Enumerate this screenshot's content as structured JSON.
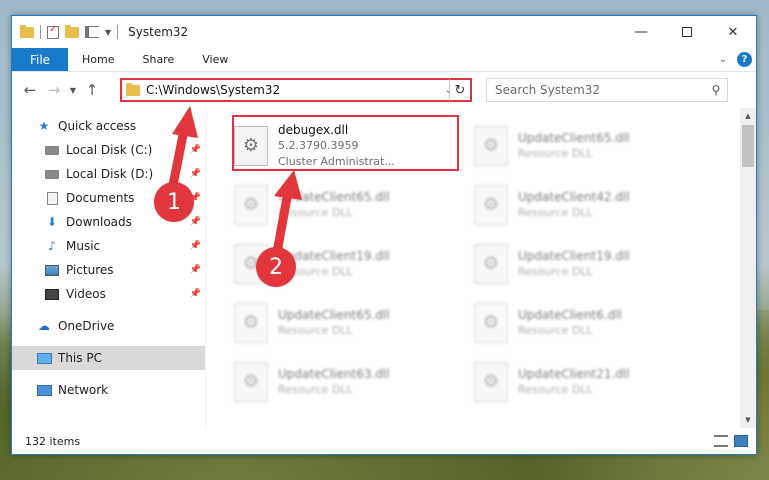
{
  "window": {
    "title": "System32",
    "controls": {
      "minimize": "—",
      "maximize": "",
      "close": "✕"
    }
  },
  "ribbon": {
    "tabs": [
      "File",
      "Home",
      "Share",
      "View"
    ],
    "help": "?"
  },
  "address_bar": {
    "path": "C:\\Windows\\System32",
    "search_placeholder": "Search System32"
  },
  "sidebar": {
    "quick_access": "Quick access",
    "pinned": [
      "Local Disk (C:)",
      "Local Disk (D:)",
      "Documents",
      "Downloads",
      "Music",
      "Pictures",
      "Videos"
    ],
    "onedrive": "OneDrive",
    "this_pc": "This PC",
    "network": "Network"
  },
  "files": [
    {
      "name": "debugex.dll",
      "line1": "5.2.3790.3959",
      "line2": "Cluster Administrat...",
      "blurred": false
    },
    {
      "name": "UpdateClient65.dll",
      "line1": "Resource DLL",
      "blurred": true
    },
    {
      "name": "UpdateClient65.dll",
      "line1": "Resource DLL",
      "blurred": true
    },
    {
      "name": "UpdateClient42.dll",
      "line1": "Resource DLL",
      "blurred": true
    },
    {
      "name": "UpdateClient19.dll",
      "line1": "Resource DLL",
      "blurred": true
    },
    {
      "name": "UpdateClient19.dll",
      "line1": "Resource DLL",
      "blurred": true
    },
    {
      "name": "UpdateClient65.dll",
      "line1": "Resource DLL",
      "blurred": true
    },
    {
      "name": "UpdateClient6.dll",
      "line1": "Resource DLL",
      "blurred": true
    },
    {
      "name": "UpdateClient63.dll",
      "line1": "Resource DLL",
      "blurred": true
    },
    {
      "name": "UpdateClient21.dll",
      "line1": "Resource DLL",
      "blurred": true
    }
  ],
  "status": {
    "item_count": "132 items"
  },
  "callouts": [
    "1",
    "2"
  ],
  "colors": {
    "accent": "#1979ca",
    "highlight": "#d9373d"
  }
}
